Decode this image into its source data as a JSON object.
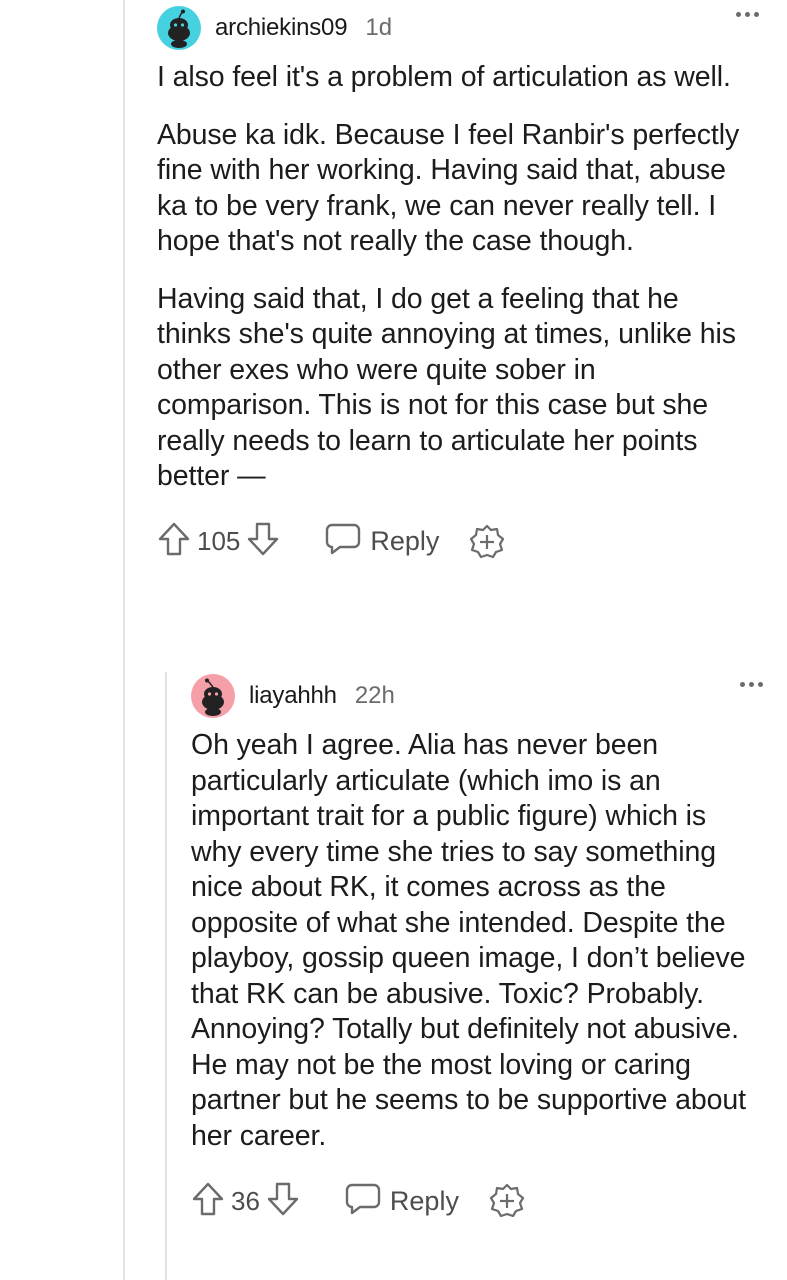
{
  "comments": [
    {
      "username": "archiekins09",
      "age": "1d",
      "paragraphs": [
        "I also feel it's a problem of articulation as well.",
        "Abuse ka idk. Because I feel Ranbir's perfectly fine with her working. Having said that, abuse ka to be very frank, we can never really tell. I hope that's not really the case though.",
        "Having said that, I do get a feeling that he thinks she's quite annoying at times, unlike his other exes who were quite sober in comparison. This is not for this case but she really needs to learn to articulate her points better —"
      ],
      "score": "105",
      "reply_label": "Reply",
      "avatar_color": "#46d1e0"
    },
    {
      "username": "liayahhh",
      "age": "22h",
      "paragraphs": [
        "Oh yeah I agree. Alia has never been particularly articulate (which imo is an important trait for a public figure) which is why every time she tries to say something nice about RK, it comes across as the opposite of what she intended. Despite the playboy, gossip queen image, I don’t believe that RK can be abusive. Toxic? Probably. Annoying? Totally but definitely not abusive. He may not be the most loving or caring partner but he seems to be supportive about her career."
      ],
      "score": "36",
      "reply_label": "Reply",
      "avatar_color": "#f5a0a8"
    }
  ],
  "icons": {
    "upvote": "upvote-arrow-icon",
    "downvote": "downvote-arrow-icon",
    "reply": "speech-bubble-icon",
    "award": "award-plus-icon",
    "more": "more-options-icon",
    "avatar": "snoo-avatar-icon"
  }
}
